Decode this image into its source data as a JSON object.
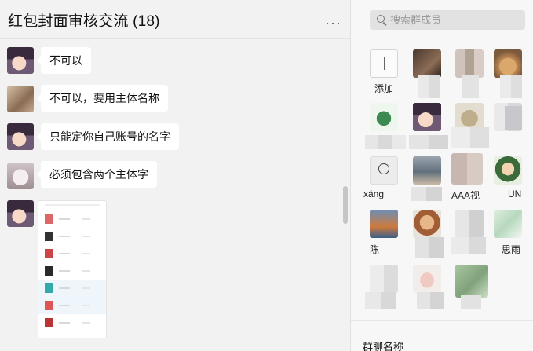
{
  "chat": {
    "title": "红包封面审核交流 (18)",
    "more_label": "···",
    "messages": [
      {
        "text": "不可以"
      },
      {
        "text": "不可以，要用主体名称"
      },
      {
        "text": "只能定你自己账号的名字"
      },
      {
        "text": "必须包含两个主体字"
      }
    ]
  },
  "window_controls": {
    "pin": "⊥",
    "minimize": "—",
    "close": "×"
  },
  "members_panel": {
    "search_placeholder": "搜索群成员",
    "add_label": "添加",
    "visible_names": [
      "xáng",
      "AAA视",
      "UN",
      "陈",
      "思雨"
    ],
    "section_title": "群聊名称"
  },
  "colors": {
    "chat_bg": "#f2f2f2",
    "panel_bg": "#f7f7f7",
    "bubble": "#ffffff"
  }
}
